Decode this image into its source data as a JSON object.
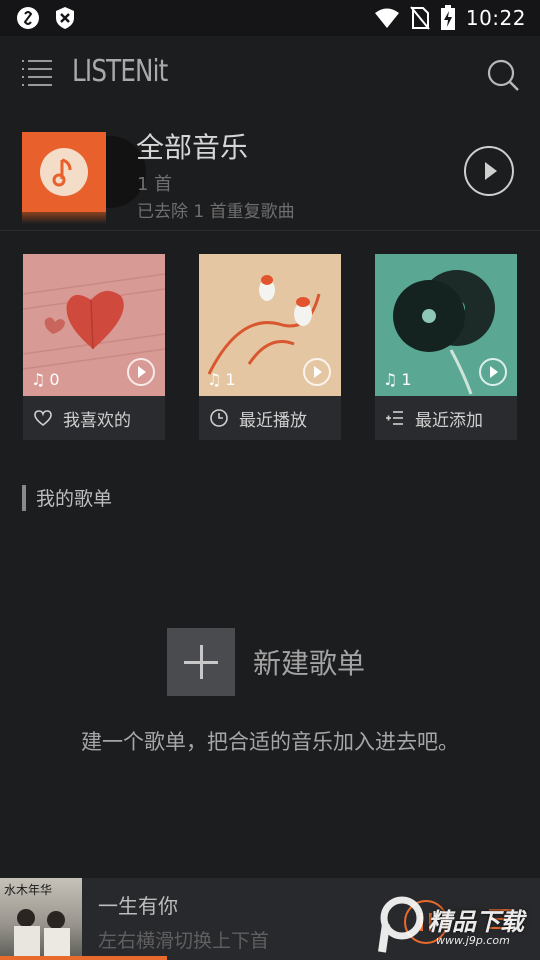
{
  "status_bar": {
    "time": "10:22",
    "icons": [
      "notification-icon",
      "shield-icon",
      "wifi-icon",
      "no-sim-icon",
      "battery-charging-icon"
    ]
  },
  "app_bar": {
    "logo": "LISTENit",
    "menu_icon": "hamburger-menu-icon",
    "search_icon": "search-icon"
  },
  "all_music": {
    "title": "全部音乐",
    "count": "1 首",
    "note": "已去除 1 首重复歌曲",
    "play_icon": "play-circle-icon"
  },
  "cards": [
    {
      "label": "我喜欢的",
      "count": "0",
      "icon": "heart-outline-icon"
    },
    {
      "label": "最近播放",
      "count": "1",
      "icon": "clock-icon"
    },
    {
      "label": "最近添加",
      "count": "1",
      "icon": "list-add-icon"
    }
  ],
  "section": {
    "title": "我的歌单"
  },
  "new_playlist": {
    "label": "新建歌单",
    "hint": "建一个歌单，把合适的音乐加入进去吧。"
  },
  "player": {
    "title": "一生有你",
    "subtitle": "左右横滑切换上下首",
    "progress": 0.31,
    "cover_text": "水木年华"
  },
  "watermark": {
    "text": "精品下载",
    "sub": "www.j9p.com"
  },
  "colors": {
    "accent": "#e86a2c",
    "background": "#1c1d1f"
  }
}
